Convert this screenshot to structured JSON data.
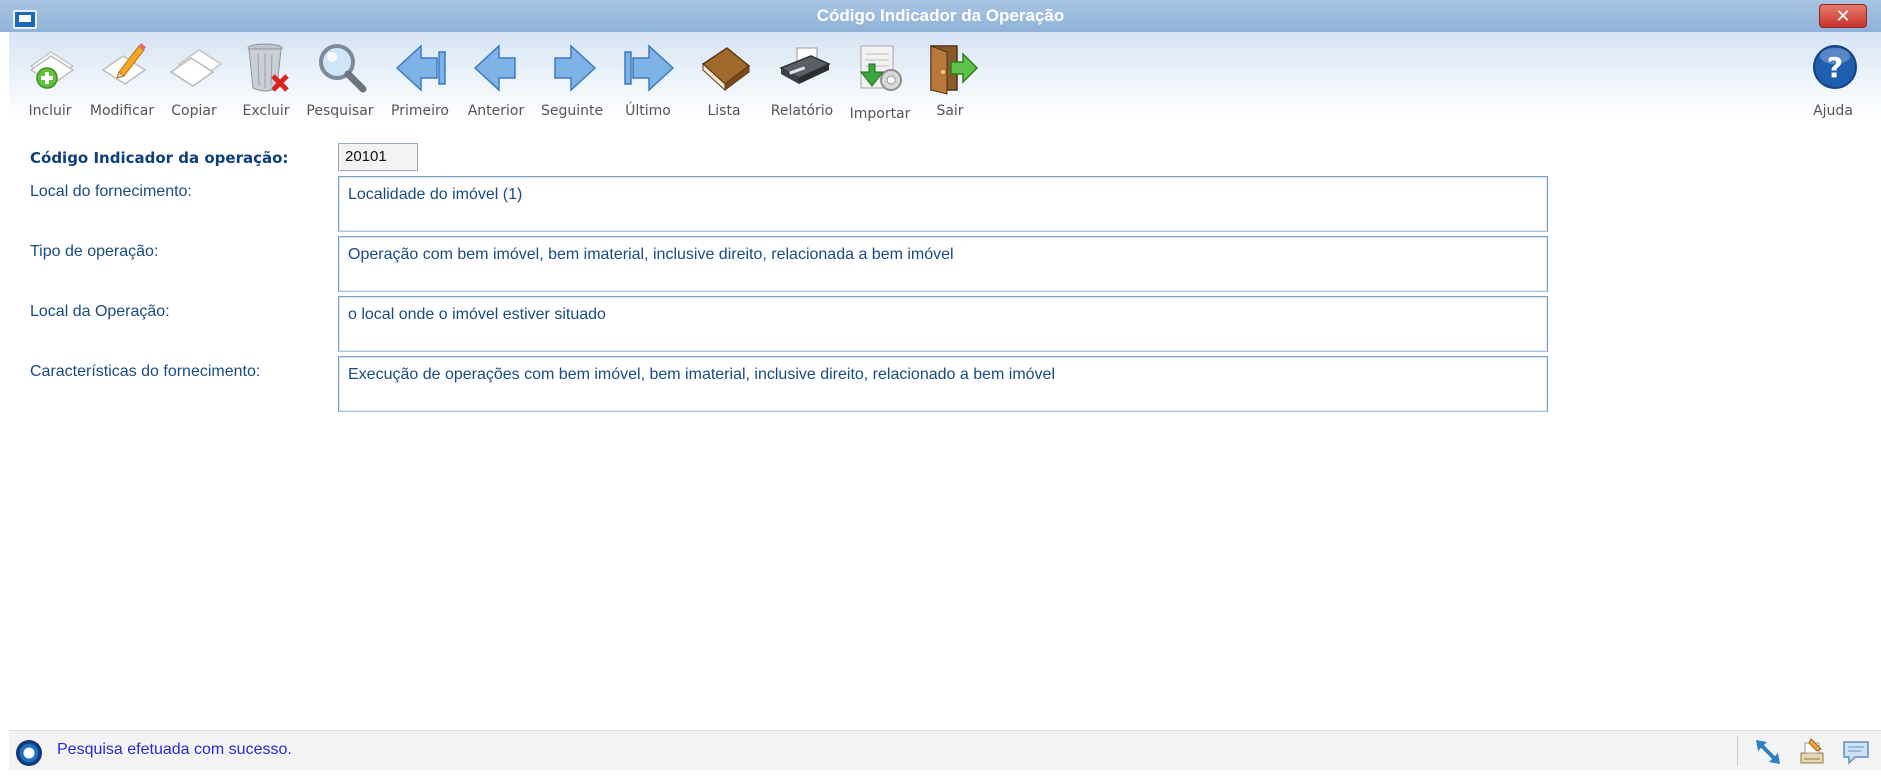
{
  "window": {
    "title": "Código Indicador da Operação"
  },
  "toolbar": {
    "buttons": [
      {
        "label": "Incluir",
        "icon": "add-document-icon"
      },
      {
        "label": "Modificar",
        "icon": "edit-document-icon"
      },
      {
        "label": "Copiar",
        "icon": "copy-document-icon"
      },
      {
        "label": "Excluir",
        "icon": "trash-delete-icon"
      },
      {
        "label": "Pesquisar",
        "icon": "search-icon"
      },
      {
        "label": "Primeiro",
        "icon": "first-arrow-icon"
      },
      {
        "label": "Anterior",
        "icon": "previous-arrow-icon"
      },
      {
        "label": "Seguinte",
        "icon": "next-arrow-icon"
      },
      {
        "label": "Último",
        "icon": "last-arrow-icon"
      },
      {
        "label": "Lista",
        "icon": "book-list-icon"
      },
      {
        "label": "Relatório",
        "icon": "printer-icon"
      },
      {
        "label": "Importar",
        "icon": "import-icon"
      },
      {
        "label": "Sair",
        "icon": "exit-door-icon"
      }
    ],
    "help": {
      "label": "Ajuda",
      "icon": "help-icon"
    }
  },
  "form": {
    "codigo_label": "Código Indicador da operação:",
    "codigo_value": "20101",
    "local_fornecimento_label": "Local do fornecimento:",
    "local_fornecimento_value": "Localidade do imóvel (1)",
    "tipo_operacao_label": "Tipo de operação:",
    "tipo_operacao_value": "Operação com bem imóvel, bem imaterial, inclusive direito,  relacionada a bem imóvel",
    "local_operacao_label": "Local da Operação:",
    "local_operacao_value": "o local onde o imóvel estiver situado",
    "caracteristicas_label": "Características do fornecimento:",
    "caracteristicas_value": "Execução de operações com bem imóvel, bem imaterial, inclusive direito, relacionado a bem imóvel"
  },
  "statusbar": {
    "message": "Pesquisa efetuada com sucesso.",
    "icons": [
      "status-logo-icon",
      "resize-arrow-icon",
      "printer-settings-icon",
      "chat-message-icon"
    ]
  },
  "colors": {
    "title_bar": "#8fb2d9",
    "label_text": "#1a4b80",
    "status_text": "#2a2ad0",
    "close_button": "#c7342a"
  }
}
